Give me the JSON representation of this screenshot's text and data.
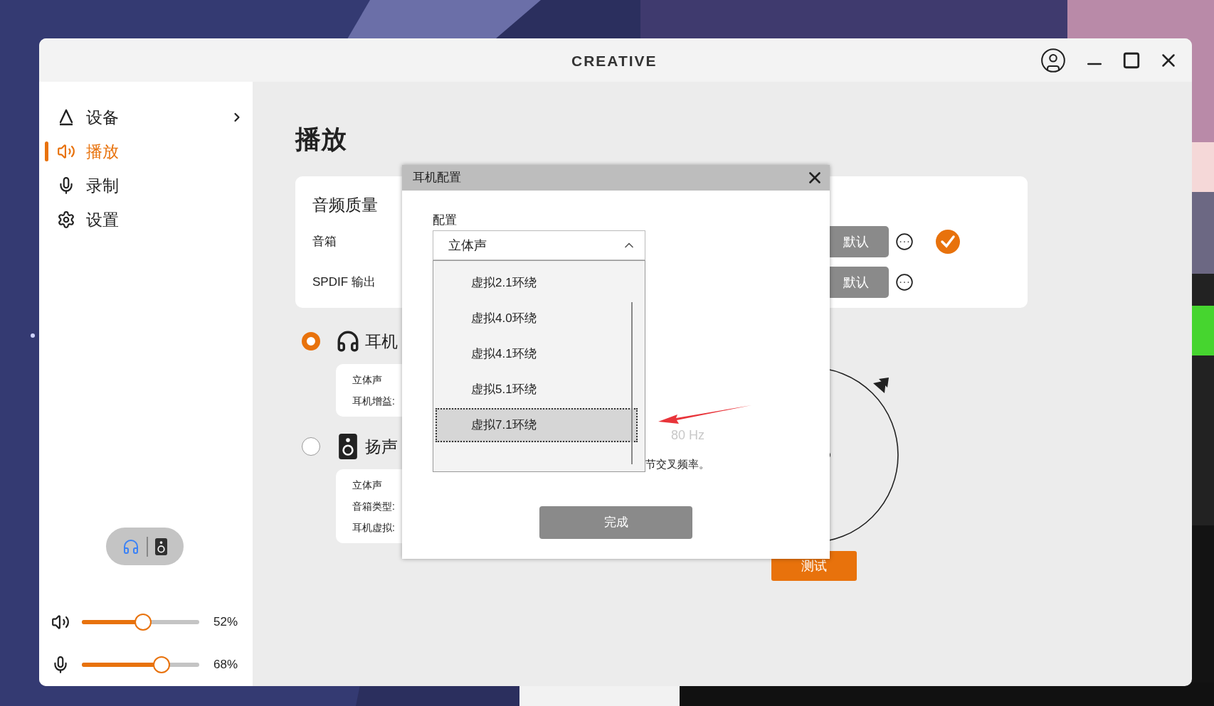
{
  "window": {
    "logo": "CREATIVE"
  },
  "sidebar": {
    "items": [
      {
        "label": "设备",
        "kind": "device",
        "selected": false,
        "expandable": true
      },
      {
        "label": "播放",
        "kind": "playback",
        "selected": true,
        "expandable": false
      },
      {
        "label": "录制",
        "kind": "record",
        "selected": false,
        "expandable": false
      },
      {
        "label": "设置",
        "kind": "settings",
        "selected": false,
        "expandable": false
      }
    ],
    "output_toggle": [
      {
        "kind": "headphones",
        "selected": true
      },
      {
        "kind": "speaker",
        "selected": false
      }
    ],
    "sliders": [
      {
        "kind": "volume",
        "level": 0.52,
        "reading": "52%"
      },
      {
        "kind": "mic",
        "level": 0.68,
        "reading": "68%"
      }
    ]
  },
  "page": {
    "title": "播放",
    "quality_card": {
      "title": "音频质量",
      "rows": [
        {
          "label": "音箱",
          "button": "默认",
          "is_default": true
        },
        {
          "label": "SPDIF 输出",
          "button": "默认",
          "is_default": false
        }
      ]
    },
    "outputs": [
      {
        "kind": "headphones",
        "label": "耳机",
        "selected": true,
        "details": [
          "立体声",
          "耳机增益:"
        ]
      },
      {
        "kind": "speaker",
        "label": "扬声",
        "selected": false,
        "details": [
          "立体声",
          "音箱类型:",
          "耳机虚拟:"
        ]
      }
    ],
    "test_button": "测试"
  },
  "dialog": {
    "title": "耳机配置",
    "field_label": "配置",
    "value": "立体声",
    "expanded": true,
    "options": [
      {
        "label": "虚拟2.1环绕",
        "selected": false
      },
      {
        "label": "虚拟4.0环绕",
        "selected": false
      },
      {
        "label": "虚拟4.1环绕",
        "selected": false
      },
      {
        "label": "虚拟5.1环绕",
        "selected": false
      },
      {
        "label": "虚拟7.1环绕",
        "selected": true
      }
    ],
    "frequency": "80 Hz",
    "hint": "节交叉频率。",
    "done_button": "完成"
  }
}
